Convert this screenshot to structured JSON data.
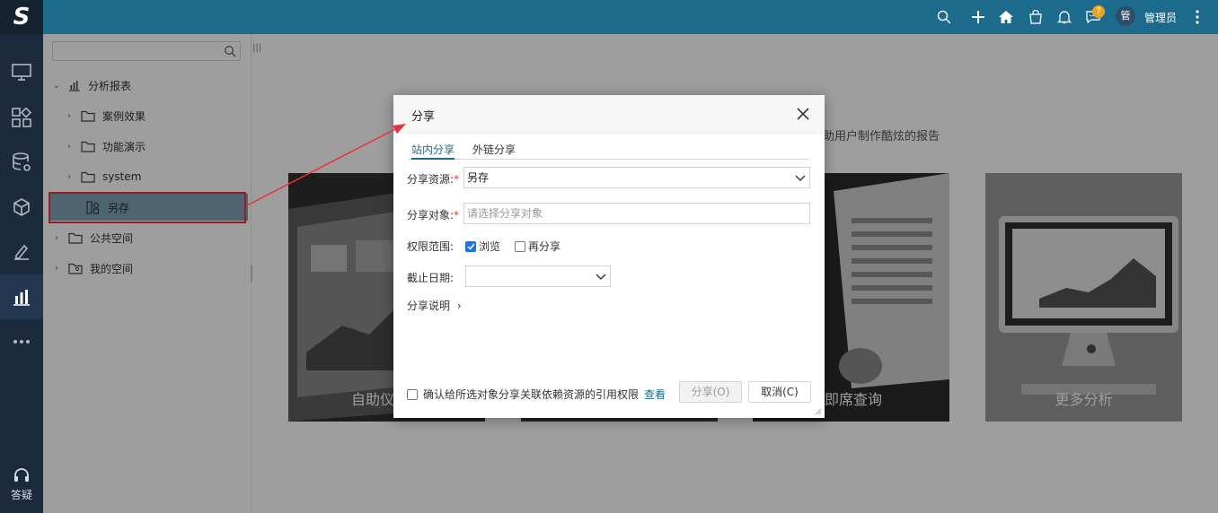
{
  "app": {
    "logo_text": "S",
    "user_initial": "管",
    "user_name": "管理员",
    "notification_count": "7"
  },
  "rail": {
    "items": [
      "desktop-icon",
      "widgets-icon",
      "database-settings-icon",
      "cube-icon",
      "edit-icon",
      "bar-chart-icon",
      "more-icon"
    ],
    "help_label": "答疑"
  },
  "topbar": {
    "icons": [
      "search-icon",
      "plus-icon",
      "home-icon",
      "bag-icon",
      "bell-icon",
      "message-icon",
      "more-vert-icon"
    ]
  },
  "sidebar": {
    "search_placeholder": "",
    "tree": [
      {
        "label": "分析报表",
        "level": 0,
        "expanded": true,
        "icon": "report-icon"
      },
      {
        "label": "案例效果",
        "level": 1,
        "expanded": false,
        "icon": "folder-icon"
      },
      {
        "label": "功能演示",
        "level": 1,
        "expanded": false,
        "icon": "folder-icon"
      },
      {
        "label": "system",
        "level": 1,
        "expanded": false,
        "icon": "folder-icon"
      },
      {
        "label": "另存",
        "level": 1,
        "selected": true,
        "icon": "resource-icon"
      },
      {
        "label": "公共空间",
        "level": 0,
        "expanded": false,
        "icon": "folder-icon"
      },
      {
        "label": "我的空间",
        "level": 0,
        "expanded": false,
        "icon": "user-folder-icon"
      }
    ]
  },
  "content": {
    "description": "助用户制作酷炫的报告",
    "cards": [
      "自助仪",
      "",
      "即席查询",
      "更多分析"
    ]
  },
  "dialog": {
    "title": "分享",
    "tabs": [
      "站内分享",
      "外链分享"
    ],
    "resource_label": "分享资源:",
    "resource_value": "另存",
    "target_label": "分享对象:",
    "target_placeholder": "请选择分享对象",
    "permission_label": "权限范围:",
    "permission_browse": "浏览",
    "permission_reshare": "再分享",
    "expiry_label": "截止日期:",
    "description_toggle": "分享说明",
    "confirm_label": "确认给所选对象分享关联依赖资源的引用权限",
    "view_link": "查看",
    "share_button": "分享(O)",
    "cancel_button": "取消(C)",
    "required_mark": "*"
  },
  "colors": {
    "topbar": "#1d6b8c",
    "rail": "#1b2a3d",
    "accent": "#1d6b8c",
    "annotation": "#e8323c",
    "selection": "#7fa3b5"
  }
}
